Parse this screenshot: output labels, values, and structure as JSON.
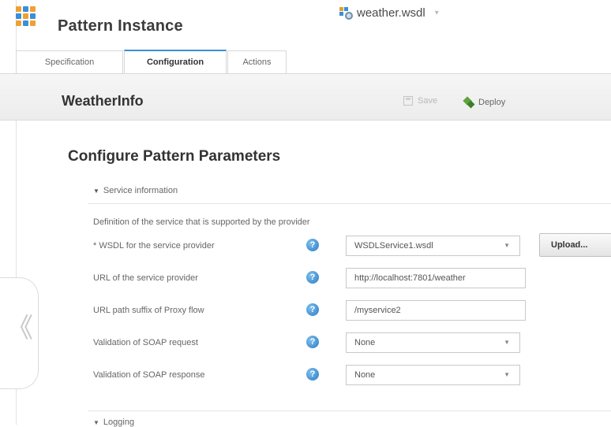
{
  "app": {
    "title": "Pattern Instance"
  },
  "file_tab": {
    "name": "weather.wsdl",
    "caret": "▾"
  },
  "tabs": [
    {
      "label": "Specification"
    },
    {
      "label": "Configuration"
    },
    {
      "label": "Actions"
    }
  ],
  "toolbar": {
    "instance_name": "WeatherInfo",
    "save_label": "Save",
    "deploy_label": "Deploy"
  },
  "main": {
    "section_title": "Configure Pattern Parameters",
    "group": {
      "label": "Service information",
      "description": "Definition of the service that is supported by the provider"
    },
    "params": [
      {
        "label": "* WSDL for the service provider",
        "value": "WSDLService1.wsdl"
      },
      {
        "label": "URL of the service provider",
        "value": "http://localhost:7801/weather"
      },
      {
        "label": "URL path suffix of Proxy flow",
        "value": "/myservice2"
      },
      {
        "label": "Validation of SOAP request",
        "value": "None"
      },
      {
        "label": "Validation of SOAP response",
        "value": "None"
      }
    ],
    "upload_label": "Upload...",
    "logging_label": "Logging"
  },
  "icons": {
    "help": "?",
    "dropdown_caret": "▼",
    "collapse": "《",
    "expanded": "▼"
  }
}
